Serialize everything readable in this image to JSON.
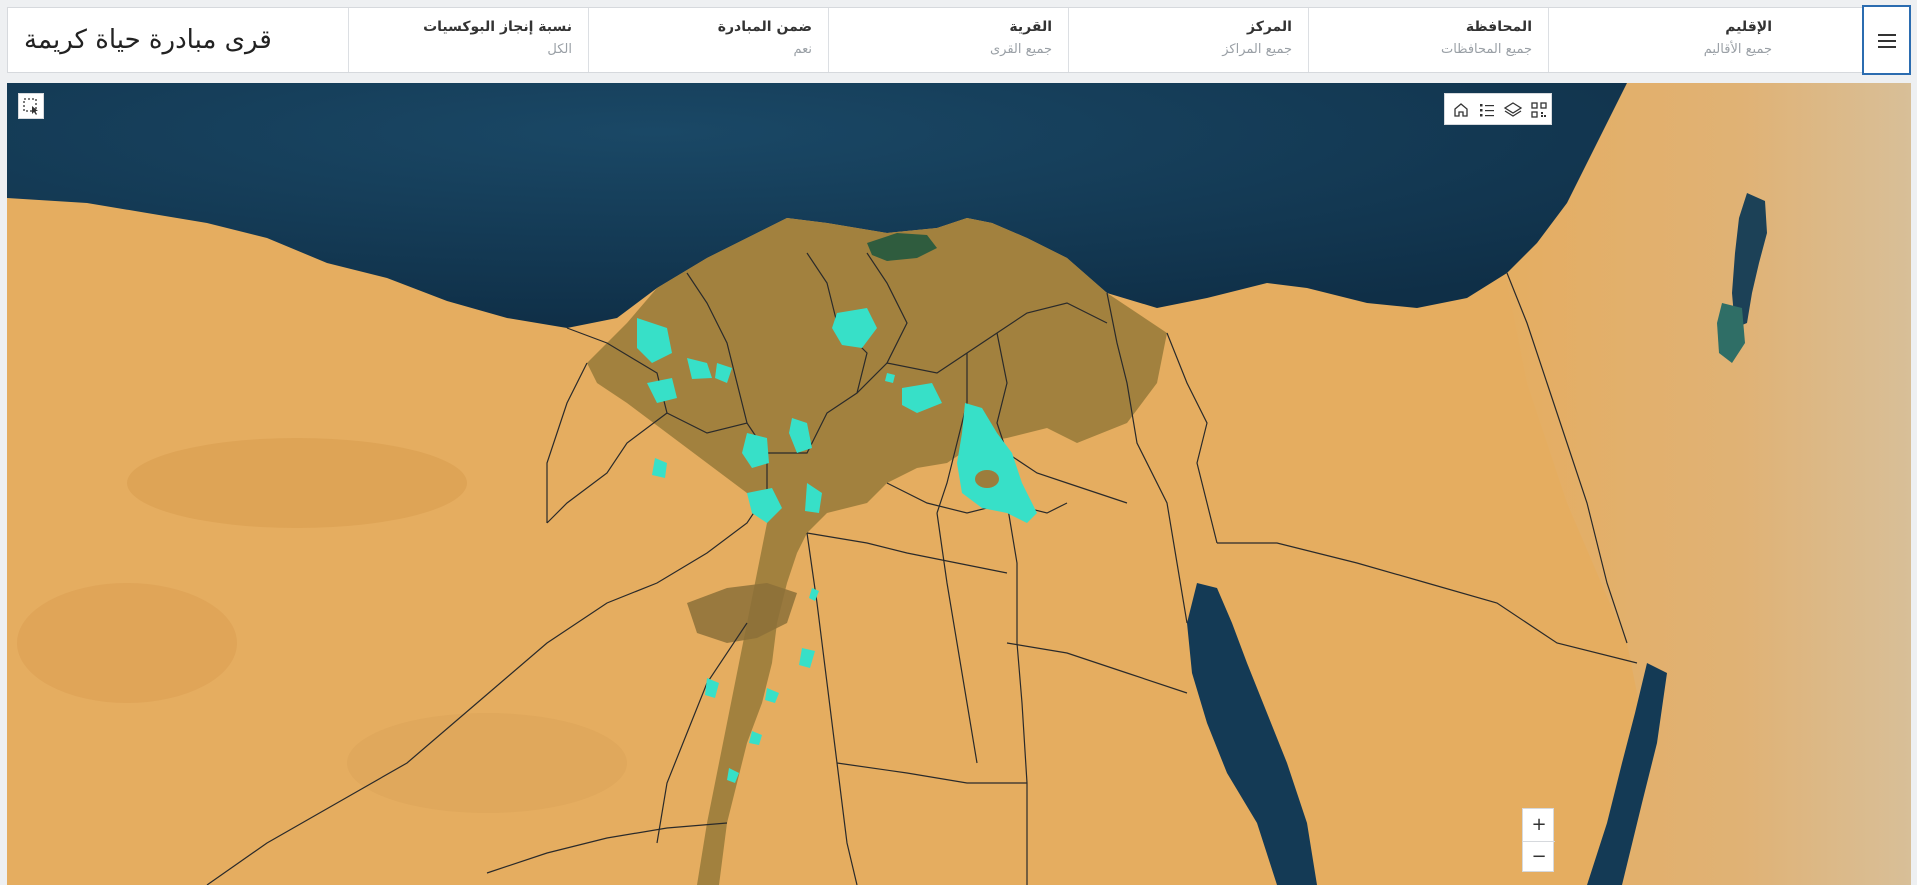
{
  "header": {
    "title": "قرى مبادرة حياة كريمة",
    "filters": [
      {
        "label": "الإقليم",
        "value": "جميع الأقاليم"
      },
      {
        "label": "المحافظة",
        "value": "جميع المحافظات"
      },
      {
        "label": "المركز",
        "value": "جميع المراكز"
      },
      {
        "label": "القرية",
        "value": "جميع القرى"
      },
      {
        "label": "ضمن المبادرة",
        "value": "نعم"
      },
      {
        "label": "نسبة إنجاز البوكسيات",
        "value": "الكل"
      }
    ]
  },
  "map": {
    "zoom_in_label": "+",
    "zoom_out_label": "−",
    "toolbar_icons": [
      "home-icon",
      "legend-icon",
      "layers-icon",
      "qr-code-icon"
    ],
    "selection_tool_icon": "select-region-icon",
    "colors": {
      "sea": "#143a55",
      "desert": "#e5ad60",
      "delta": "#9c7d3c",
      "sinai_rock": "#dcc39a",
      "village_highlight": "#37e0c8",
      "boundary": "#2a2a2a"
    }
  }
}
